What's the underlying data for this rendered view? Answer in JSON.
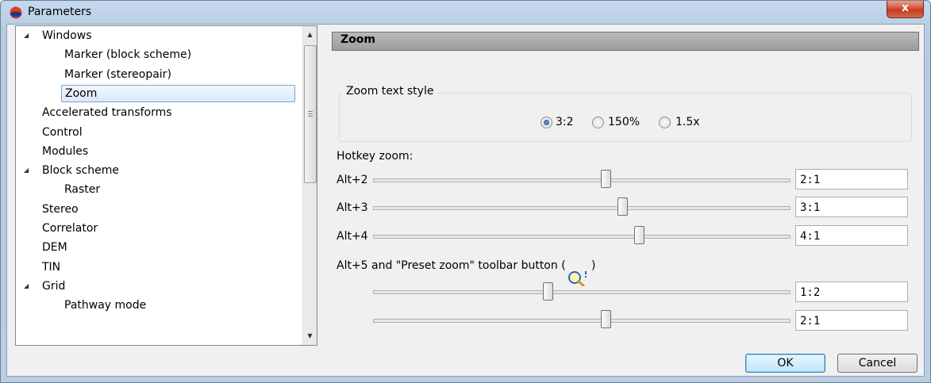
{
  "window": {
    "title": "Parameters",
    "close_label": "x"
  },
  "tree": {
    "items": [
      {
        "label": "Windows",
        "level": 0,
        "expanded": true
      },
      {
        "label": "Marker (block scheme)",
        "level": 1
      },
      {
        "label": "Marker (stereopair)",
        "level": 1
      },
      {
        "label": "Zoom",
        "level": 1,
        "selected": true
      },
      {
        "label": "Accelerated transforms",
        "level": 0
      },
      {
        "label": "Control",
        "level": 0
      },
      {
        "label": "Modules",
        "level": 0
      },
      {
        "label": "Block scheme",
        "level": 0,
        "expanded": true
      },
      {
        "label": "Raster",
        "level": 1
      },
      {
        "label": "Stereo",
        "level": 0
      },
      {
        "label": "Correlator",
        "level": 0
      },
      {
        "label": "DEM",
        "level": 0
      },
      {
        "label": "TIN",
        "level": 0
      },
      {
        "label": "Grid",
        "level": 0,
        "expanded": true
      },
      {
        "label": "Pathway mode",
        "level": 1
      }
    ],
    "expander_glyph": "◢",
    "scroll_up": "▲",
    "scroll_down": "▼"
  },
  "panel": {
    "header": "Zoom",
    "zoom_text_style": {
      "title": "Zoom text style",
      "options": [
        "3:2",
        "150%",
        "1.5x"
      ],
      "selected": "3:2"
    },
    "hotkey_zoom": {
      "title": "Hotkey zoom:",
      "rows": [
        {
          "label": "Alt+2",
          "value": "2:1",
          "slider": 0.56
        },
        {
          "label": "Alt+3",
          "value": "3:1",
          "slider": 0.6
        },
        {
          "label": "Alt+4",
          "value": "4:1",
          "slider": 0.64
        }
      ]
    },
    "preset": {
      "label_before": "Alt+5 and \"Preset zoom\" toolbar button (",
      "label_after": ")",
      "icon": "magnifier-icon",
      "rows": [
        {
          "value": "1:2",
          "slider": 0.42
        },
        {
          "value": "2:1",
          "slider": 0.56
        }
      ]
    }
  },
  "buttons": {
    "ok": "OK",
    "cancel": "Cancel"
  },
  "colors": {
    "selection_bg": "#d9e8fa",
    "selection_border": "#7da2ce",
    "header_bg": "#a9a9a9",
    "close_red": "#c8452a"
  }
}
